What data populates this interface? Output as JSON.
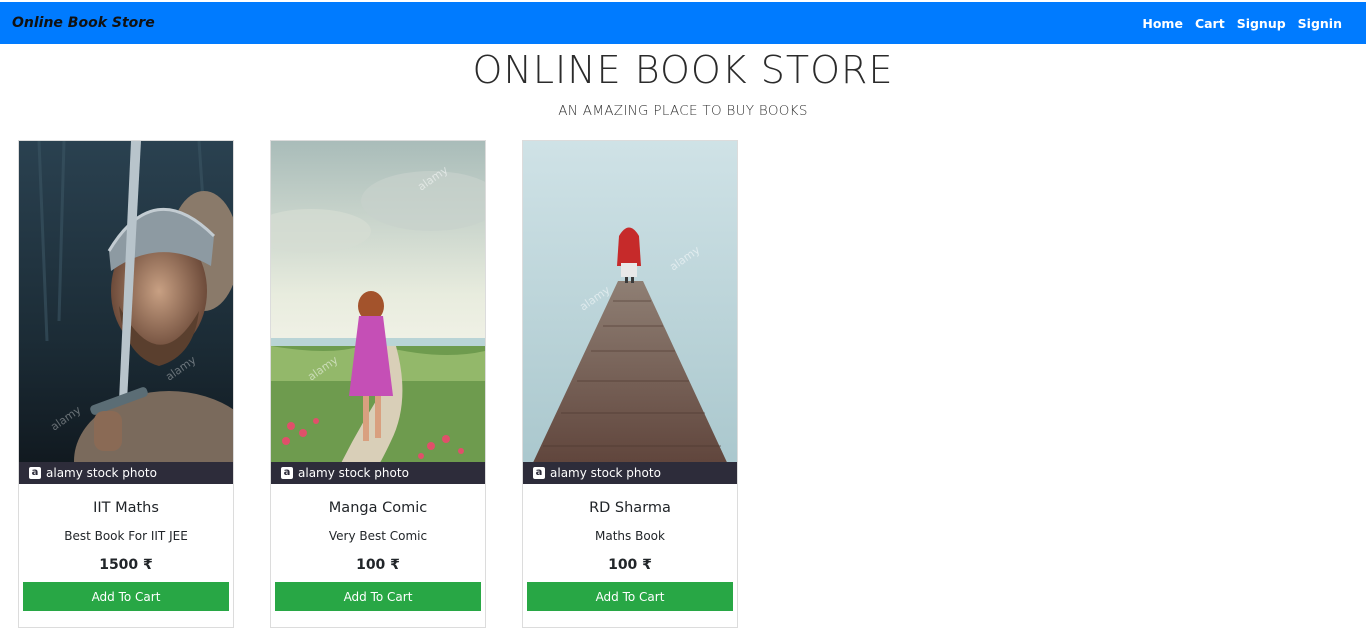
{
  "navbar": {
    "brand": "Online Book Store",
    "links": [
      "Home",
      "Cart",
      "Signup",
      "Signin"
    ],
    "color": "#007bff"
  },
  "hero": {
    "title": "ONLINE BOOK STORE",
    "subtitle": "AN AMAZING PLACE TO BUY BOOKS"
  },
  "books": [
    {
      "title": "IIT Maths",
      "description": "Best Book For IIT JEE",
      "price": "1500 ₹",
      "button": "Add To Cart",
      "image_caption": "alamy stock photo"
    },
    {
      "title": "Manga Comic",
      "description": "Very Best Comic",
      "price": "100 ₹",
      "button": "Add To Cart",
      "image_caption": "alamy stock photo"
    },
    {
      "title": "RD Sharma",
      "description": "Maths Book",
      "price": "100 ₹",
      "button": "Add To Cart",
      "image_caption": "alamy stock photo"
    }
  ],
  "colors": {
    "button": "#28a745",
    "watermark_bar": "#2d2c3a"
  }
}
